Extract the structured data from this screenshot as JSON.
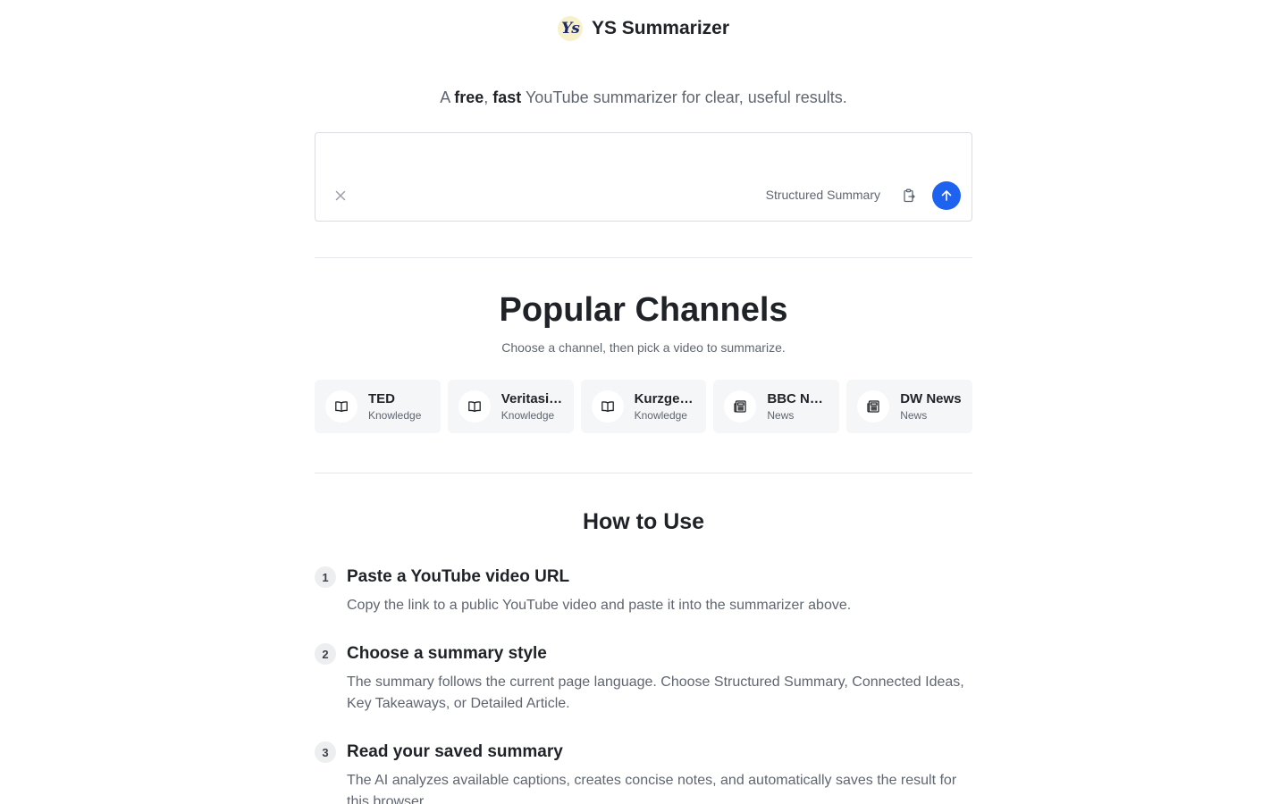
{
  "header": {
    "logo_text": "Ys",
    "title": "YS Summarizer"
  },
  "tagline": {
    "prefix": "A ",
    "bold1": "free",
    "sep": ", ",
    "bold2": "fast",
    "suffix": " YouTube summarizer for clear, useful results."
  },
  "input": {
    "value": "",
    "placeholder": "",
    "clear_icon": "close-icon",
    "style_value": "Structured Summary",
    "paste_icon": "clipboard-paste-icon",
    "submit_icon": "arrow-up-icon",
    "accent_color": "#1d63f0"
  },
  "popular": {
    "title": "Popular Channels",
    "subtitle": "Choose a channel, then pick a video to summarize.",
    "channels": [
      {
        "name": "TED",
        "category": "Knowledge",
        "icon": "book-open-icon"
      },
      {
        "name": "Veritasium",
        "category": "Knowledge",
        "icon": "book-open-icon"
      },
      {
        "name": "Kurzgesagt",
        "category": "Knowledge",
        "icon": "book-open-icon"
      },
      {
        "name": "BBC News",
        "category": "News",
        "icon": "newspaper-icon"
      },
      {
        "name": "DW News",
        "category": "News",
        "icon": "newspaper-icon"
      }
    ]
  },
  "howto": {
    "title": "How to Use",
    "steps": [
      {
        "num": "1",
        "title": "Paste a YouTube video URL",
        "desc": "Copy the link to a public YouTube video and paste it into the summarizer above."
      },
      {
        "num": "2",
        "title": "Choose a summary style",
        "desc": "The summary follows the current page language. Choose Structured Summary, Connected Ideas, Key Takeaways, or Detailed Article."
      },
      {
        "num": "3",
        "title": "Read your saved summary",
        "desc": "The AI analyzes available captions, creates concise notes, and automatically saves the result for this browser."
      }
    ]
  }
}
